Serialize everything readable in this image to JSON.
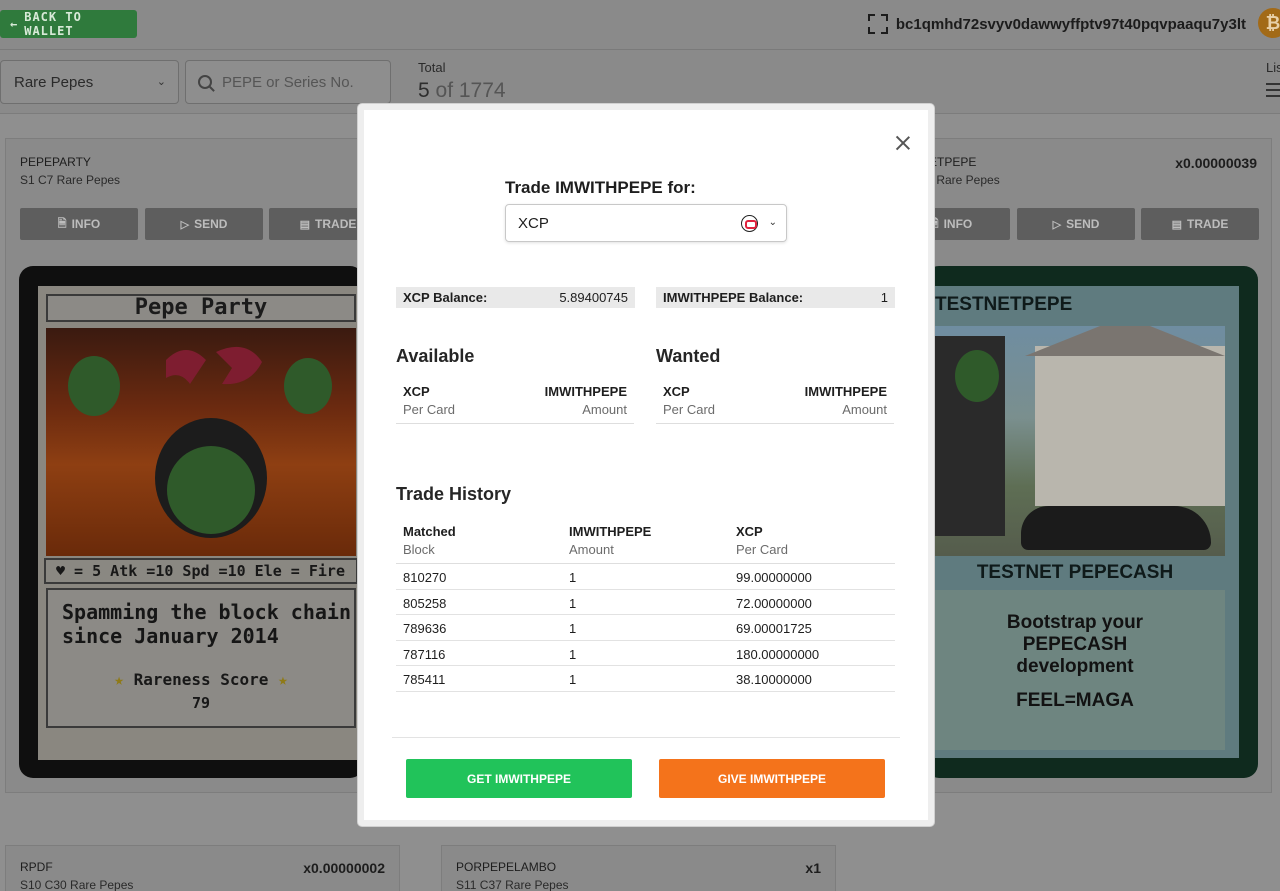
{
  "topbar": {
    "back_label": "BACK TO WALLET",
    "wallet_address": "bc1qmhd72svyv0dawwyffptv97t40pqvpaaqu7y3lt",
    "btc_symbol": "₿"
  },
  "filters": {
    "collection_selected": "Rare Pepes",
    "search_placeholder": "PEPE or Series No.",
    "total_label": "Total",
    "total_shown": "5",
    "total_of": "of 1774",
    "list_label": "Lis"
  },
  "cards": [
    {
      "name": "PEPEPARTY",
      "series": "S1 C7 Rare Pepes",
      "buttons": [
        "INFO",
        "SEND",
        "TRADE"
      ],
      "art": {
        "title": "Pepe Party",
        "stats": "♥ = 5   Atk =10  Spd =10 Ele = Fire",
        "text_line1": "Spamming the block chain",
        "text_line2": "since January 2014",
        "rareness_label": "Rareness Score",
        "rareness_value": "79"
      }
    },
    {
      "name": "ETPEPE",
      "series": "- Rare Pepes",
      "qty": "x0.00000039",
      "buttons": [
        "INFO",
        "SEND",
        "TRADE"
      ],
      "art": {
        "title": "TESTNETPEPE",
        "subtitle": "TESTNET PEPECASH",
        "body_line1": "Bootstrap your",
        "body_line2": "PEPECASH",
        "body_line3": "development",
        "body_line4": "FEEL=MAGA"
      }
    },
    {
      "name": "RPDF",
      "series": "S10 C30 Rare Pepes",
      "qty": "x0.00000002"
    },
    {
      "name": "PORPEPELAMBO",
      "series": "S11 C37 Rare Pepes",
      "qty": "x1"
    }
  ],
  "modal": {
    "trade_label": "Trade IMWITHPEPE for:",
    "selected_asset": "XCP",
    "xcp_balance_label": "XCP Balance:",
    "xcp_balance_value": "5.89400745",
    "asset_balance_label": "IMWITHPEPE Balance:",
    "asset_balance_value": "1",
    "available": {
      "title": "Available",
      "col1_head": "XCP",
      "col1_sub": "Per Card",
      "col2_head": "IMWITHPEPE",
      "col2_sub": "Amount"
    },
    "wanted": {
      "title": "Wanted",
      "col1_head": "XCP",
      "col1_sub": "Per Card",
      "col2_head": "IMWITHPEPE",
      "col2_sub": "Amount"
    },
    "history": {
      "title": "Trade History",
      "headers": [
        {
          "head": "Matched",
          "sub": "Block"
        },
        {
          "head": "IMWITHPEPE",
          "sub": "Amount"
        },
        {
          "head": "XCP",
          "sub": "Per Card"
        }
      ],
      "rows": [
        [
          "810270",
          "1",
          "99.00000000"
        ],
        [
          "805258",
          "1",
          "72.00000000"
        ],
        [
          "789636",
          "1",
          "69.00001725"
        ],
        [
          "787116",
          "1",
          "180.00000000"
        ],
        [
          "785411",
          "1",
          "38.10000000"
        ]
      ]
    },
    "get_label": "GET IMWITHPEPE",
    "give_label": "GIVE IMWITHPEPE"
  },
  "colors": {
    "get_button": "#21c35a",
    "give_button": "#f4731b",
    "back_button": "#2f7a3c"
  }
}
